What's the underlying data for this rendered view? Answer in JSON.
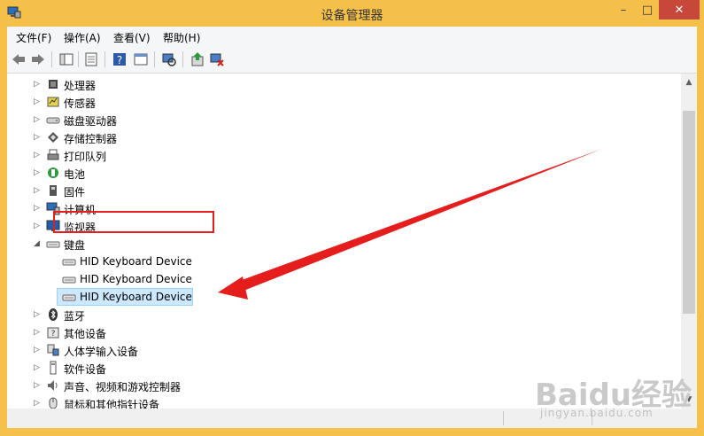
{
  "window": {
    "title": "设备管理器",
    "minimize": "–",
    "maximize": "□",
    "close": "✕"
  },
  "menu": {
    "file": "文件(F)",
    "action": "操作(A)",
    "view": "查看(V)",
    "help": "帮助(H)"
  },
  "toolbar": {
    "icons": [
      "back-icon",
      "forward-icon",
      "tree-view-icon",
      "properties-icon",
      "help-icon",
      "console-tree-icon",
      "scan-hardware-icon",
      "update-driver-icon",
      "uninstall-device-icon"
    ]
  },
  "tree": {
    "processor": "处理器",
    "sensor": "传感器",
    "disk": "磁盘驱动器",
    "storage": "存储控制器",
    "print_queue": "打印队列",
    "battery": "电池",
    "firmware": "固件",
    "computer": "计算机",
    "monitor": "监视器",
    "keyboard": "键盘",
    "kb1": "HID Keyboard Device",
    "kb2": "HID Keyboard Device",
    "kb3": "HID Keyboard Device",
    "bluetooth": "蓝牙",
    "other": "其他设备",
    "hid": "人体学输入设备",
    "software": "软件设备",
    "audio": "声音、视频和游戏控制器",
    "mouse": "鼠标和其他指针设备"
  },
  "watermark": {
    "brand": "Baidu经验",
    "url": "jingyan.baidu.com"
  },
  "colors": {
    "titlebar": "#f5c04a",
    "close_button": "#c7473a",
    "annotation": "#e51d1d",
    "selection": "#cce8ff"
  }
}
